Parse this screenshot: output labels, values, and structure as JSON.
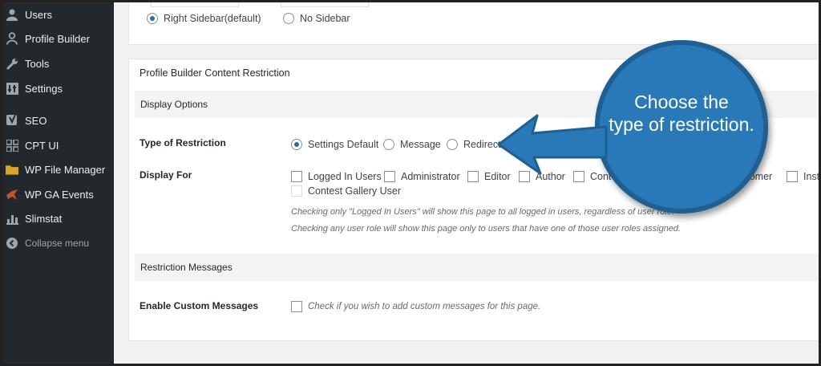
{
  "sidebar": {
    "items": [
      {
        "label": "Users",
        "icon": "users-icon"
      },
      {
        "label": "Profile Builder",
        "icon": "profile-icon"
      },
      {
        "label": "Tools",
        "icon": "wrench-icon"
      },
      {
        "label": "Settings",
        "icon": "settings-icon"
      },
      {
        "label": "SEO",
        "icon": "seo-icon"
      },
      {
        "label": "CPT UI",
        "icon": "grid-icon"
      },
      {
        "label": "WP File Manager",
        "icon": "folder-icon"
      },
      {
        "label": "WP GA Events",
        "icon": "bird-icon"
      },
      {
        "label": "Slimstat",
        "icon": "chart-icon"
      }
    ],
    "collapse_label": "Collapse menu"
  },
  "layout_box": {
    "options": [
      {
        "label": "Right Sidebar(default)",
        "selected": true
      },
      {
        "label": "No Sidebar",
        "selected": false
      }
    ]
  },
  "restriction_box": {
    "title": "Profile Builder Content Restriction",
    "display_options_heading": "Display Options",
    "type_label": "Type of Restriction",
    "type_options": [
      {
        "label": "Settings Default",
        "selected": true
      },
      {
        "label": "Message",
        "selected": false
      },
      {
        "label": "Redirect",
        "selected": false
      }
    ],
    "display_for_label": "Display For",
    "display_for_options": [
      "Logged In Users",
      "Administrator",
      "Editor",
      "Author",
      "Cont",
      "stomer",
      "Inst",
      "Contest Gallery User"
    ],
    "hint_1": "Checking only \"Logged In Users\" will show this page to all logged in users, regardless of user role.",
    "hint_2": "Checking any user role will show this page only to users that have one of those user roles assigned.",
    "messages_heading": "Restriction Messages",
    "custom_messages_label": "Enable Custom Messages",
    "custom_messages_hint": "Check if you wish to add custom messages for this page."
  },
  "callout": {
    "line1": "Choose the",
    "line2": "type of restriction.",
    "color": "#2979b8"
  }
}
